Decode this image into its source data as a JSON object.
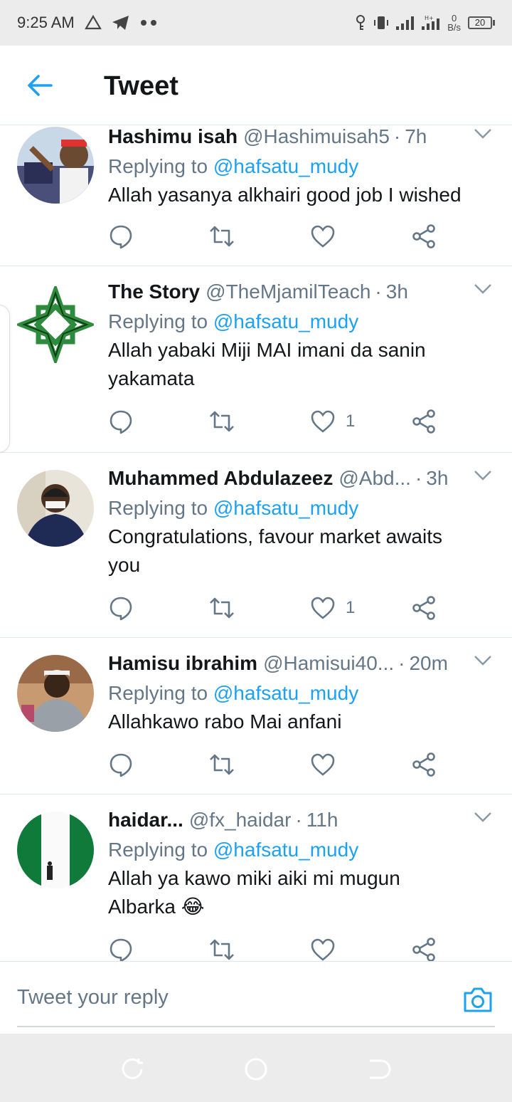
{
  "status_bar": {
    "time": "9:25 AM",
    "net_speed_value": "0",
    "net_speed_unit": "B/s",
    "battery": "20"
  },
  "header": {
    "title": "Tweet"
  },
  "replying_label": "Replying to",
  "tweets": [
    {
      "name": "Hashimu isah",
      "handle": "@Hashimuisah5",
      "time": "7h",
      "reply_to": "@hafsatu_mudy",
      "text": "Allah yasanya alkhairi  good job I wished",
      "likes": ""
    },
    {
      "name": "The Story",
      "handle": "@TheMjamilTeach",
      "time": "3h",
      "reply_to": "@hafsatu_mudy",
      "text": "Allah yabaki Miji MAI imani da sanin yakamata",
      "likes": "1"
    },
    {
      "name": "Muhammed Abdulazeez",
      "handle": "@Abd...",
      "time": "3h",
      "reply_to": "@hafsatu_mudy",
      "text": "Congratulations, favour market awaits you",
      "likes": "1"
    },
    {
      "name": "Hamisu ibrahim",
      "handle": "@Hamisui40...",
      "time": "20m",
      "reply_to": "@hafsatu_mudy",
      "text": "Allahkawo rabo Mai anfani",
      "likes": ""
    },
    {
      "name": "haidar...",
      "handle": "@fx_haidar",
      "time": "11h",
      "reply_to": "@hafsatu_mudy",
      "text": "Allah ya kawo miki aiki mi mugun Albarka 😂",
      "likes": ""
    }
  ],
  "reply_bar": {
    "placeholder": "Tweet your reply"
  },
  "colors": {
    "accent": "#1da1f2",
    "secondary_text": "#657786",
    "divider": "#e1e8ed"
  },
  "icons": [
    "back-arrow-icon",
    "reply-icon",
    "retweet-icon",
    "like-icon",
    "share-icon",
    "caret-down-icon",
    "camera-icon"
  ]
}
